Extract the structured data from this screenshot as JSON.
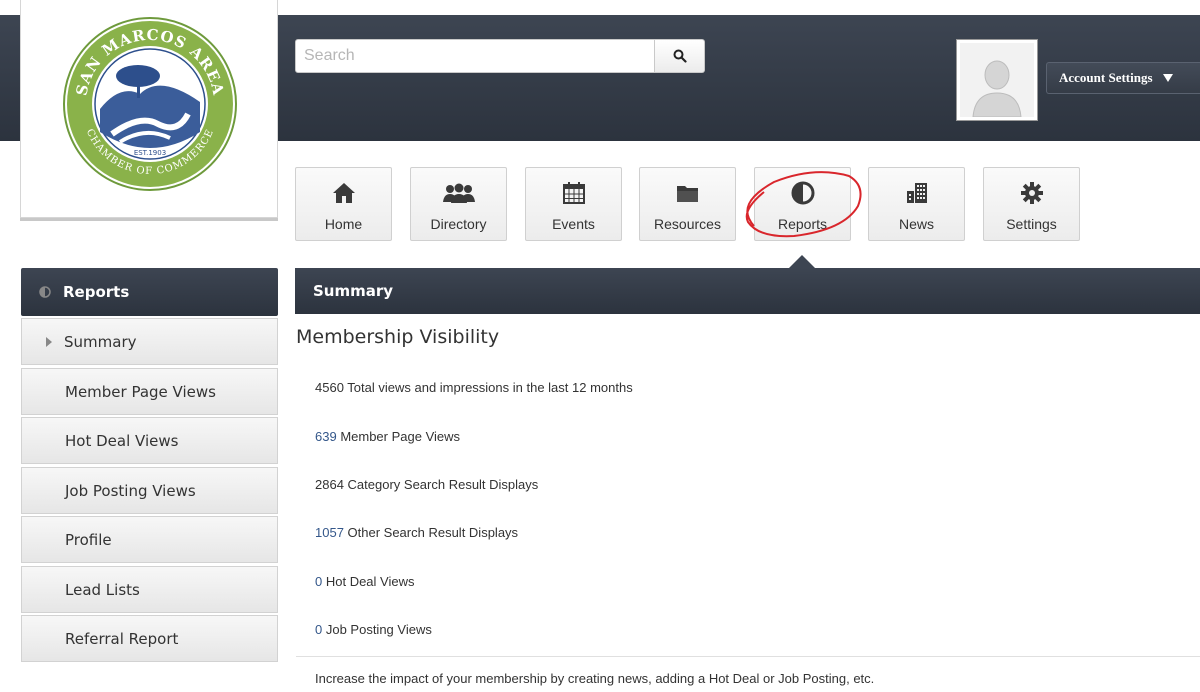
{
  "logo": {
    "top_text": "SAN MARCOS AREA",
    "bottom_text": "CHAMBER OF COMMERCE",
    "established": "EST.1903"
  },
  "search": {
    "placeholder": "Search",
    "icon": "search-icon"
  },
  "account": {
    "label": "Account Settings",
    "icon": "caret-down-icon"
  },
  "nav": {
    "tiles": [
      {
        "label": "Home",
        "icon": "home-icon"
      },
      {
        "label": "Directory",
        "icon": "users-icon"
      },
      {
        "label": "Events",
        "icon": "calendar-icon"
      },
      {
        "label": "Resources",
        "icon": "folder-icon"
      },
      {
        "label": "Reports",
        "icon": "pie-chart-icon"
      },
      {
        "label": "News",
        "icon": "building-icon"
      },
      {
        "label": "Settings",
        "icon": "gear-icon"
      }
    ],
    "highlight_color": "#d9262c"
  },
  "sidebar": {
    "header": "Reports",
    "items": [
      {
        "label": "Summary"
      },
      {
        "label": "Member Page Views"
      },
      {
        "label": "Hot Deal Views"
      },
      {
        "label": "Job Posting Views"
      },
      {
        "label": "Profile"
      },
      {
        "label": "Lead Lists"
      },
      {
        "label": "Referral Report"
      }
    ]
  },
  "main": {
    "bar_title": "Summary",
    "section_title": "Membership Visibility",
    "stats": [
      {
        "value": "4560",
        "text": " Total views and impressions in the last 12 months"
      },
      {
        "value": "639",
        "text": " Member Page Views"
      },
      {
        "value": "2864",
        "text": " Category Search Result Displays"
      },
      {
        "value": "1057",
        "text": " Other Search Result Displays"
      },
      {
        "value": "0",
        "text": " Hot Deal Views"
      },
      {
        "value": "0",
        "text": " Job Posting Views"
      }
    ],
    "footer_note": "Increase the impact of your membership by creating news, adding a Hot Deal or Job Posting, etc."
  },
  "colors": {
    "header_bg": "#353c47",
    "link": "#34578a",
    "logo_green": "#8ab24a",
    "logo_blue": "#2d4f8c"
  }
}
